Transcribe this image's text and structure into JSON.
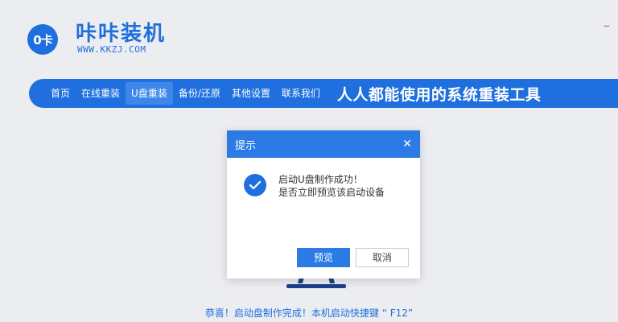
{
  "app": {
    "logo_text": "0卡",
    "title": "咔咔装机",
    "url": "WWW.KKZJ.COM",
    "minimize": "–"
  },
  "nav": {
    "items": [
      {
        "label": "首页"
      },
      {
        "label": "在线重装"
      },
      {
        "label": "U盘重装",
        "active": true
      },
      {
        "label": "备份/还原"
      },
      {
        "label": "其他设置"
      },
      {
        "label": "联系我们"
      }
    ],
    "slogan": "人人都能使用的系统重装工具"
  },
  "dialog": {
    "title": "提示",
    "close": "✕",
    "message_line1": "启动U盘制作成功！",
    "message_line2": "是否立即预览该启动设备",
    "preview_label": "预览",
    "cancel_label": "取消"
  },
  "footer": {
    "text": "恭喜！启动盘制作完成！本机启动快捷键 “ F12”"
  },
  "colors": {
    "brand": "#1f6fde",
    "dialog_header": "#2c7be5",
    "background": "#ecedf0"
  }
}
